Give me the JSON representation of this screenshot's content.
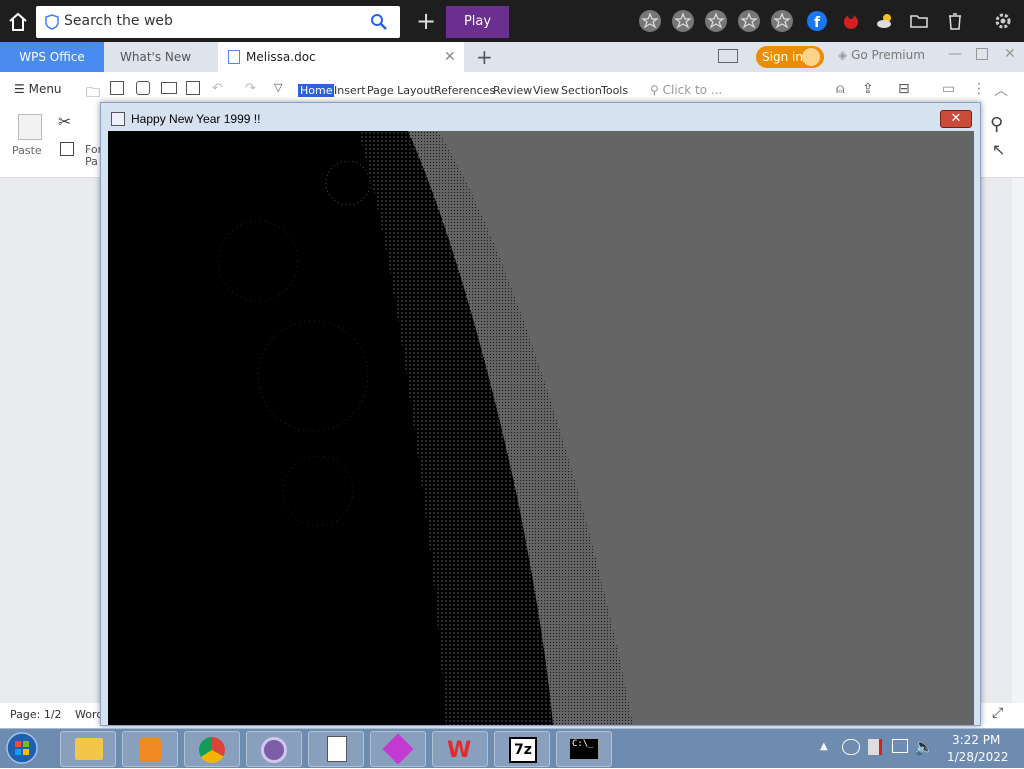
{
  "browser": {
    "search_text": "Search the web",
    "play_label": "Play"
  },
  "tabs": {
    "wps": "WPS Office",
    "whats_new": "What's New",
    "doc": "Melissa.doc"
  },
  "account": {
    "signin": "Sign in",
    "premium": "Go Premium"
  },
  "ribbon": {
    "menu": "Menu",
    "tabs": [
      "Home",
      "Insert",
      "Page Layout",
      "References",
      "Review",
      "View",
      "Section",
      "Tools"
    ],
    "search_placeholder": "Click to ...",
    "paste": "Paste",
    "format_painter_partial": "For Pa"
  },
  "status": {
    "page": "Page: 1/2",
    "word_partial": "Word"
  },
  "popup": {
    "title": "Happy New Year 1999 !!",
    "close": "✕"
  },
  "clock": {
    "time": "3:22 PM",
    "date": "1/28/2022"
  },
  "colors": {
    "wps_blue": "#4a8bf0",
    "play_purple": "#6b2f8f",
    "signin_orange": "#ec8c00",
    "close_red": "#c94b3a"
  }
}
